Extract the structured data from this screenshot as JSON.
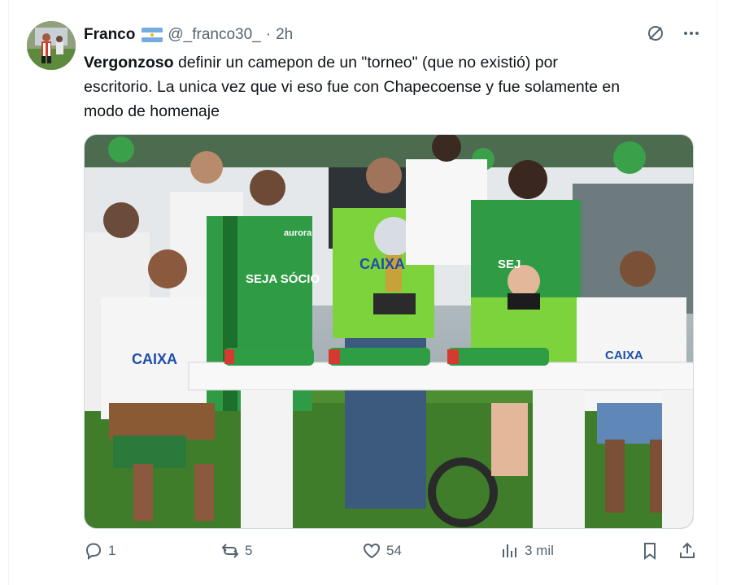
{
  "author": {
    "name": "Franco",
    "handle": "@_franco30_",
    "separator": "·",
    "time": "2h",
    "flag_icon": "argentina-flag-icon"
  },
  "tweet": {
    "text_bold": "Vergonzoso",
    "text_line1": " definir un camepon de un \"torneo\" (que no existió) por",
    "text_line2": "escritorio. La unica vez que vi eso fue con Chapecoense y fue solamente en",
    "text_line3": "modo de homenaje"
  },
  "media": {
    "shirt_sponsor_1": "SEJA SÓCIO",
    "shirt_sponsor_2": "CAIXA",
    "shirt_sponsor_3": "CAIXA",
    "shirt_sponsor_4": "CAIXA",
    "shirt_sponsor_5": "SEJ",
    "shirt_brand": "aurora"
  },
  "stats": {
    "replies": "1",
    "reposts": "5",
    "likes": "54",
    "views": "3 mil"
  },
  "colors": {
    "text_primary": "#0f1419",
    "text_secondary": "#536471",
    "border": "#cfd9de",
    "grass": "#3f7d2a",
    "green_kit": "#2f9b45",
    "lime_kit": "#7cd33c"
  }
}
